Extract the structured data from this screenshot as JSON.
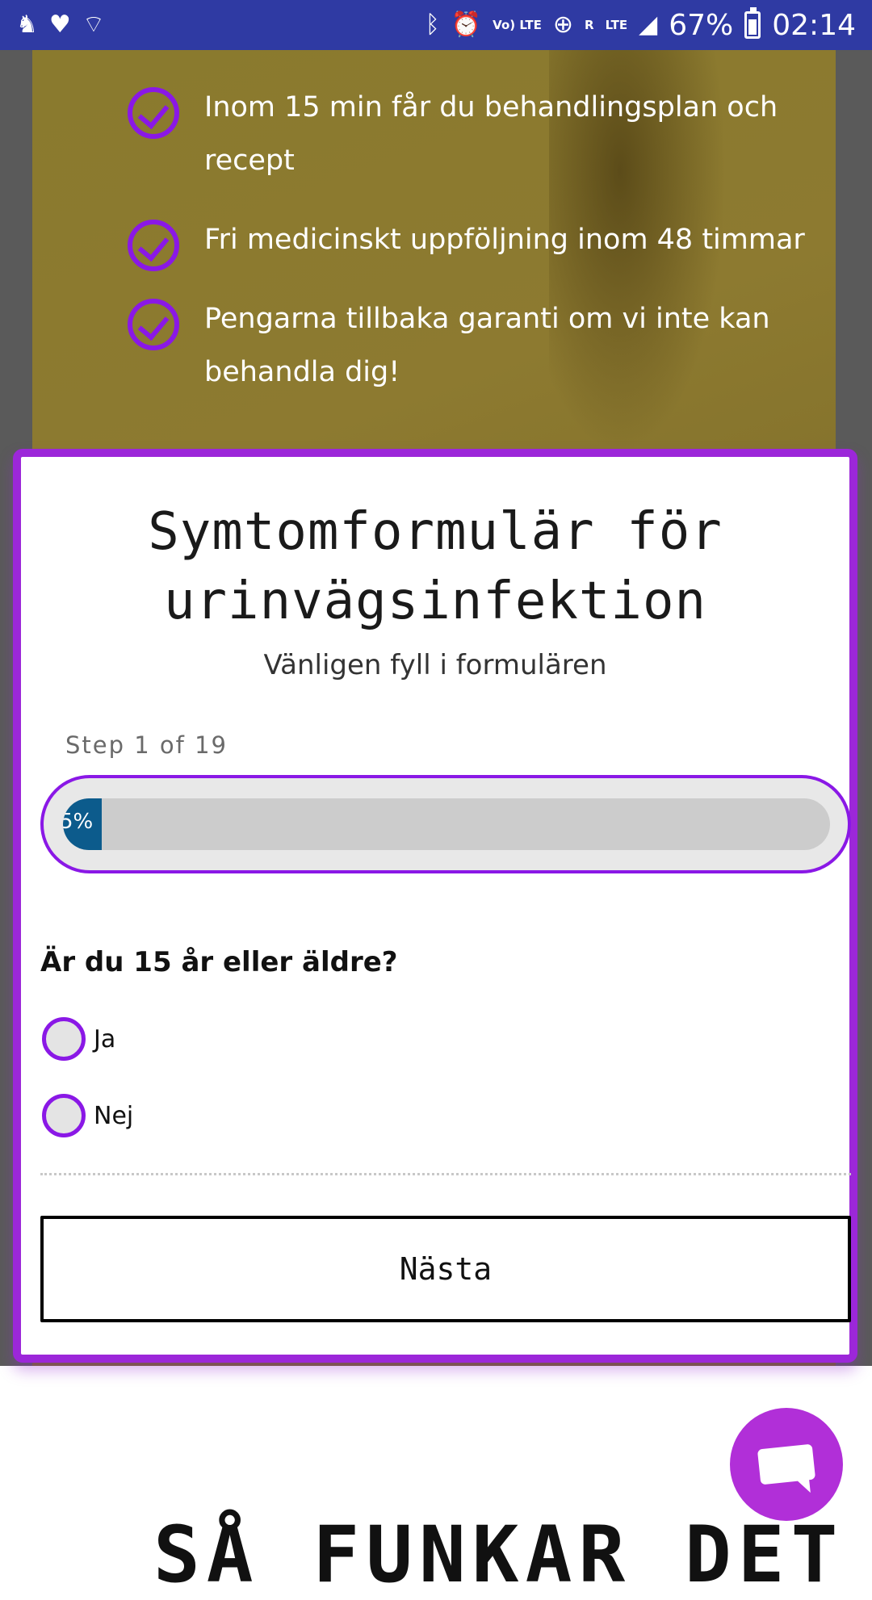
{
  "status_bar": {
    "battery": "67%",
    "time": "02:14",
    "network_labels": [
      "Vo) LTE",
      "R",
      "LTE"
    ]
  },
  "hero": {
    "bullets": [
      "Inom 15 min får du behandlingsplan och recept",
      "Fri medicinskt uppföljning inom 48 timmar",
      "Pengarna tillbaka garanti om vi inte kan behandla dig!"
    ]
  },
  "form": {
    "title": "Symtomformulär för urinvägsinfektion",
    "subtitle": "Vänligen fyll i formulären",
    "step_label": "Step 1 of 19",
    "progress_percent": 5,
    "progress_text": "5%",
    "question": "Är du 15 år eller äldre?",
    "options": [
      "Ja",
      "Nej"
    ],
    "next_label": "Nästa"
  },
  "below": {
    "heading": "SÅ FUNKAR DET"
  },
  "colors": {
    "status_bar": "#2f3aa3",
    "accent_purple": "#9c27d9",
    "progress_fill": "#0c5b8c",
    "chat_button": "#b12fd8"
  }
}
